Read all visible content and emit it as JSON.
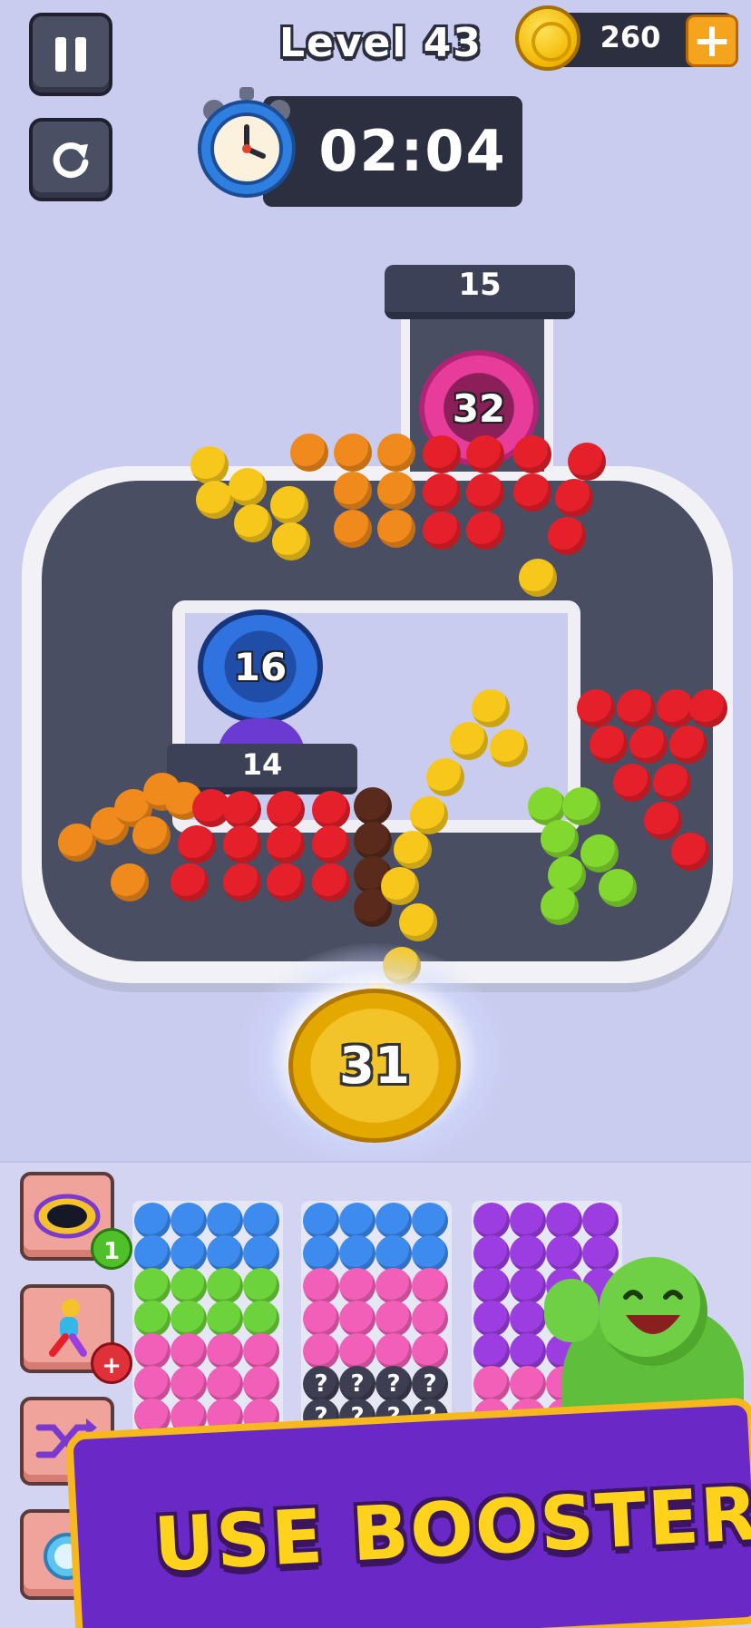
{
  "hud": {
    "level_label": "Level 43",
    "coins": "260",
    "timer": "02:04",
    "pause_icon": "pause-icon",
    "restart_icon": "restart-icon",
    "clock_icon": "alarm-clock-icon",
    "coin_icon": "coin-icon",
    "add_icon": "plus-icon"
  },
  "board": {
    "tower_count": "15",
    "gates": [
      {
        "color": "#e83c9b",
        "count": "32"
      },
      {
        "color": "#2f72e0",
        "count": "16"
      }
    ],
    "sign_count": "14",
    "portal_count": "31"
  },
  "boosters": [
    {
      "icon": "hole-icon",
      "badge": "1",
      "badge_color": "#4fbf2a"
    },
    {
      "icon": "rainbow-runner-icon",
      "badge": "+",
      "badge_color": "#e0303a"
    },
    {
      "icon": "shuffle-icon"
    },
    {
      "icon": "freeze-clock-icon"
    }
  ],
  "banner": {
    "text": "USE BOOSTERS !"
  },
  "colors": {
    "background": "#c9cbef",
    "track": "#4a4e63",
    "banner": "#6a29c7",
    "banner_text": "#ffd21c"
  }
}
